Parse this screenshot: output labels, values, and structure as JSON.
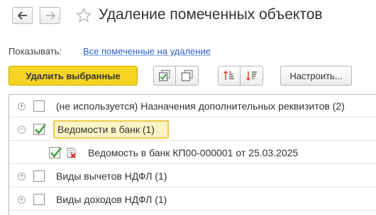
{
  "window": {
    "title": "Удаление помеченных объектов"
  },
  "nav": {
    "back_icon": "arrow-left-icon",
    "forward_icon": "arrow-right-icon",
    "favorite_icon": "star-icon"
  },
  "filter": {
    "label": "Показывать:",
    "value": "Все помеченные на удаление"
  },
  "toolbar": {
    "delete_label": "Удалить выбранные",
    "check_all_icon": "check-all-icon",
    "uncheck_all_icon": "uncheck-all-icon",
    "sort_asc_icon": "sort-ascending-icon",
    "sort_desc_icon": "sort-descending-icon",
    "settings_label": "Настроить..."
  },
  "tree": {
    "rows": [
      {
        "label": "(не используется) Назначения дополнительных реквизитов (2)",
        "checked": false,
        "expanded": false
      },
      {
        "label": "Ведомости в банк (1)",
        "checked": true,
        "expanded": true
      },
      {
        "label": "Ведомость в банк КП00-000001 от 25.03.2025",
        "checked": true,
        "child": true
      },
      {
        "label": "Виды вычетов НДФЛ (1)",
        "checked": false,
        "expanded": false
      },
      {
        "label": "Виды доходов НДФЛ (1)",
        "checked": false,
        "expanded": false
      }
    ]
  },
  "colors": {
    "primary_button": "#f5d422",
    "link": "#2c60c8",
    "checkmark": "#3fa23f",
    "focus_highlight": "#f0c84e"
  }
}
